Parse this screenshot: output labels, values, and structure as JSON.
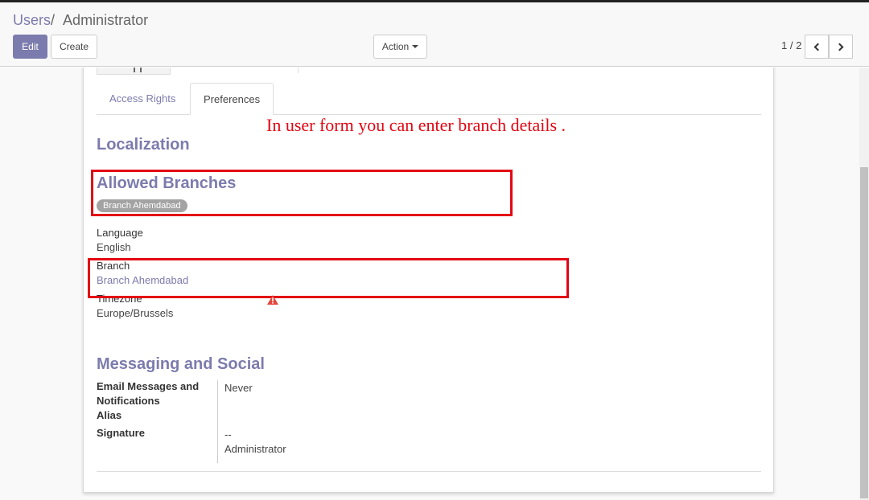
{
  "breadcrumb": {
    "parent": "Users",
    "separator": "/",
    "current": "Administrator"
  },
  "toolbar": {
    "edit_label": "Edit",
    "create_label": "Create",
    "action_label": "Action"
  },
  "pager": {
    "value": "1 / 2"
  },
  "tabs": [
    {
      "label": "Access Rights"
    },
    {
      "label": "Preferences"
    }
  ],
  "annotation": {
    "text": "In user form you can enter branch details ."
  },
  "localization": {
    "title": "Localization",
    "allowed_branches": {
      "title": "Allowed Branches",
      "tag": "Branch Ahemdabad"
    },
    "language": {
      "label": "Language",
      "value": "English"
    },
    "branch": {
      "label": "Branch",
      "value": "Branch Ahemdabad"
    },
    "timezone": {
      "label": "Timezone",
      "value": "Europe/Brussels"
    }
  },
  "messaging": {
    "title": "Messaging and Social",
    "email_label_lines": [
      "Email Messages and",
      "Notifications"
    ],
    "email_value": "Never",
    "alias_label": "Alias",
    "signature_label": "Signature",
    "signature_lines": [
      "--",
      "Administrator"
    ]
  },
  "colors": {
    "accent": "#7c7bad",
    "annotation_red": "#e30613",
    "warning": "#e4463c"
  },
  "icons": {
    "pager_prev": "chevron-left-icon",
    "pager_next": "chevron-right-icon",
    "warning": "warning-icon"
  }
}
